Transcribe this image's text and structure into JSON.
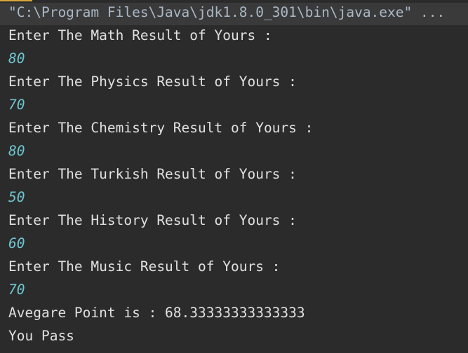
{
  "command": "\"C:\\Program Files\\Java\\jdk1.8.0_301\\bin\\java.exe\" ...",
  "prompts": [
    {
      "text": "Enter The Math Result of Yours :",
      "input": "80"
    },
    {
      "text": "Enter The Physics Result of Yours :",
      "input": "70"
    },
    {
      "text": "Enter The Chemistry Result of Yours :",
      "input": "80"
    },
    {
      "text": "Enter The Turkish Result of Yours :",
      "input": "50"
    },
    {
      "text": "Enter The History Result of Yours :",
      "input": "60"
    },
    {
      "text": "Enter The Music Result of Yours :",
      "input": "70"
    }
  ],
  "average_line": "Avegare Point is : 68.33333333333333",
  "result_line": "You Pass",
  "colors": {
    "background": "#2b2b2b",
    "command_bar": "#3a3a3a",
    "user_input": "#6fc6d1",
    "text": "#e0e0e0"
  }
}
